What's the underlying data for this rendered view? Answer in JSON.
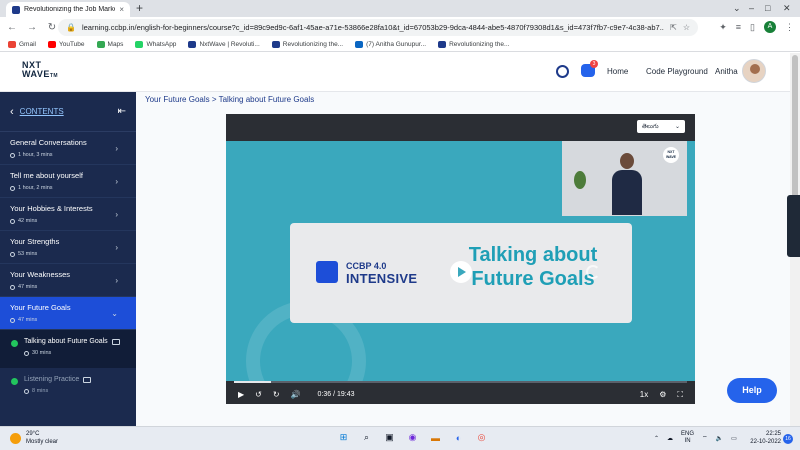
{
  "browser": {
    "tab_title": "Revolutionizing the Job Market |",
    "tab_close": "×",
    "new_tab": "+",
    "url": "learning.ccbp.in/english-for-beginners/course?c_id=89c9ed9c-6af1-45ae-a71e-53866e28fa10&t_id=67053b29-9dca-4844-abe5-4870f79308d1&s_id=473f7fb7-c9e7-4c38-ab7...",
    "profile_initial": "A",
    "bookmarks": [
      {
        "label": "Gmail",
        "color": "#ea4335"
      },
      {
        "label": "YouTube",
        "color": "#ff0000"
      },
      {
        "label": "Maps",
        "color": "#34a853"
      },
      {
        "label": "WhatsApp",
        "color": "#25d366"
      },
      {
        "label": "NxtWave | Revoluti...",
        "color": "#1e3a8a"
      },
      {
        "label": "Revolutionizing the...",
        "color": "#1e3a8a"
      },
      {
        "label": "(7) Anitha Gunupur...",
        "color": "#0a66c2"
      },
      {
        "label": "Revolutionizing the...",
        "color": "#1e3a8a"
      }
    ]
  },
  "header": {
    "logo_top": "NXT",
    "logo_bottom": "WAVE",
    "logo_tm": "TM",
    "notification_count": "3",
    "home": "Home",
    "code_playground": "Code Playground",
    "user_name": "Anitha"
  },
  "sidebar": {
    "contents_label": "CONTENTS",
    "modules": [
      {
        "title": "General Conversations",
        "duration": "1 hour, 3 mins"
      },
      {
        "title": "Tell me about yourself",
        "duration": "1 hour, 2 mins"
      },
      {
        "title": "Your Hobbies & Interests",
        "duration": "42 mins"
      },
      {
        "title": "Your Strengths",
        "duration": "53 mins"
      },
      {
        "title": "Your Weaknesses",
        "duration": "47 mins"
      },
      {
        "title": "Your Future Goals",
        "duration": "47 mins"
      }
    ],
    "lessons": [
      {
        "title": "Talking about Future Goals",
        "duration": "30 mins"
      },
      {
        "title": "Listening Practice",
        "duration": "8 mins"
      }
    ]
  },
  "main": {
    "breadcrumb": "Your Future Goals > Talking about Future Goals",
    "language_select": "తెలుగు",
    "video": {
      "brand_version": "CCBP 4.0",
      "brand_name": "INTENSIVE",
      "title_line1": "Talking about",
      "title_line2": "Future Goals",
      "current_time": "0:36",
      "total_time": "19:43",
      "progress_fraction": 0.031,
      "speed": "1x",
      "speaker_badge": "NXT WAVE"
    },
    "help_label": "Help"
  },
  "taskbar": {
    "temperature": "29°C",
    "weather": "Mostly clear",
    "lang_line1": "ENG",
    "lang_line2": "IN",
    "time": "22:25",
    "date": "22-10-2022",
    "notifications": "16"
  }
}
